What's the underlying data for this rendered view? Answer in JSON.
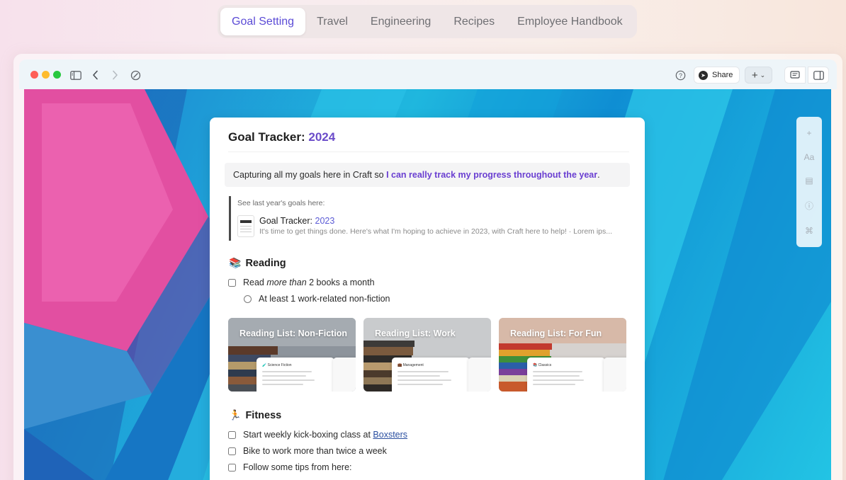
{
  "topnav": {
    "tabs": [
      {
        "label": "Goal Setting",
        "active": true
      },
      {
        "label": "Travel",
        "active": false
      },
      {
        "label": "Engineering",
        "active": false
      },
      {
        "label": "Recipes",
        "active": false
      },
      {
        "label": "Employee Handbook",
        "active": false
      }
    ]
  },
  "window": {
    "traffic_lights": {
      "close": "#fe5f57",
      "minimize": "#febc2e",
      "zoom": "#28c840"
    },
    "toolbar": {
      "share_label": "Share",
      "icons": [
        "sidebar-toggle-icon",
        "back-icon",
        "forward-icon",
        "sync-icon",
        "help-icon",
        "plus-icon",
        "comment-icon",
        "panel-icon"
      ]
    },
    "side_tools": [
      "+",
      "Aa",
      "▤",
      "ⓘ",
      "⌘"
    ]
  },
  "doc": {
    "title_prefix": "Goal Tracker: ",
    "title_year": "2024",
    "callout_prefix": "Capturing all my goals here in Craft so ",
    "callout_highlight": "I can really track my progress throughout the year",
    "callout_suffix": ".",
    "quote_label": "See last year's goals here:",
    "linked_card": {
      "title_prefix": "Goal Tracker: ",
      "title_year": "2023",
      "snippet": "It's time to get things done. Here's what I'm hoping to achieve in 2023, with Craft here to help! · Lorem ips..."
    },
    "reading": {
      "emoji": "📚",
      "heading": "Reading",
      "task1_pre": "Read ",
      "task1_em": "more than",
      "task1_post": " 2 books a month",
      "subtask": "At least 1 work-related non-fiction",
      "cards": [
        {
          "label": "Reading List: Non-Fiction",
          "sheet_heading": "🧪 Science Fiction"
        },
        {
          "label": "Reading List: Work",
          "sheet_heading": "💼 Management"
        },
        {
          "label": "Reading List: For Fun",
          "sheet_heading": "📚 Classics"
        }
      ]
    },
    "fitness": {
      "emoji": "🏃",
      "heading": "Fitness",
      "task1_pre": "Start weekly kick-boxing class at ",
      "task1_link": "Boxsters",
      "task2": "Bike to work more than twice a week",
      "task3": "Follow some tips from here:"
    }
  },
  "colors": {
    "accent": "#6a4bc9",
    "tab_active_text": "#5b4bd6"
  }
}
